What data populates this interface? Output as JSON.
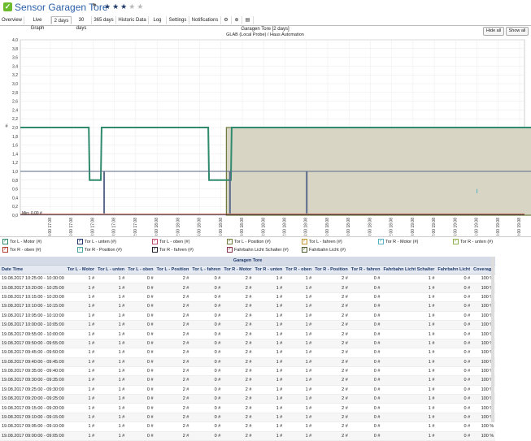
{
  "header": {
    "title": "Sensor Garagen Tore",
    "flag": "⚑",
    "rating": 3,
    "max_rating": 5
  },
  "tabs": [
    "Overview",
    "Live Graph",
    "2 days",
    "30 days",
    "365 days",
    "Historic Data",
    "Log",
    "Settings",
    "Notifications",
    "",
    "",
    ""
  ],
  "active_tab": "2 days",
  "buttons": {
    "hide_all": "Hide all",
    "show_all": "Show all"
  },
  "chart_data": {
    "type": "line",
    "title": "Garagen Tore [2 days]",
    "subtitle": "GLAB (Local Probe) / Haus Automation",
    "ylabel": "#",
    "ylim": [
      0,
      4.0
    ],
    "yticks": [
      "0,0",
      "0,2",
      "0,4",
      "0,6",
      "0,8",
      "1,0",
      "1,2",
      "1,4",
      "1,6",
      "1,8",
      "2,0",
      "2,2",
      "2,4",
      "2,6",
      "2,8",
      "3,0",
      "3,2",
      "3,4",
      "3,6",
      "3,8",
      "4,0"
    ],
    "xticks": [
      "17.08 14:00",
      "17.08 16:00",
      "17.08 18:00",
      "17.08 20:00",
      "17.08 22:00",
      "18.08 00:00",
      "18.08 02:00",
      "18.08 04:00",
      "18.08 06:00",
      "18.08 08:00",
      "18.08 10:00",
      "18.08 12:00",
      "18.08 14:00",
      "18.08 16:00",
      "18.08 18:00",
      "18.08 20:00",
      "18.08 22:00",
      "19.08 00:00",
      "19.08 02:00",
      "19.08 04:00",
      "19.08 06:00",
      "19.08 08:00",
      "19.08 10:00"
    ],
    "max_label": "Max: 2,00 #",
    "min_label": "Min: 0,00 #",
    "grid": true,
    "series": [
      {
        "name": "Tor L - Motor",
        "color": "#2f8a6e"
      },
      {
        "name": "Tor L - unten",
        "color": "#1f3a6b"
      },
      {
        "name": "Tor L - oben",
        "color": "#c44a6a"
      },
      {
        "name": "Tor L - Position",
        "color": "#6b7a3b"
      },
      {
        "name": "Tor L - fahren",
        "color": "#c2952d"
      },
      {
        "name": "Tor R - Motor",
        "color": "#5ab3c4"
      },
      {
        "name": "Tor R - unten",
        "color": "#8fb04a"
      },
      {
        "name": "Tor R - oben",
        "color": "#b33a2a"
      },
      {
        "name": "Tor R - Position",
        "color": "#4aa6a0"
      },
      {
        "name": "Tor R - fahren",
        "color": "#222233"
      },
      {
        "name": "Fahrbahn Licht Schalter",
        "color": "#8a2e4a"
      },
      {
        "name": "Fahrbahn Licht",
        "color": "#4a5a2a"
      }
    ]
  },
  "legend": [
    "Tor L - Motor (#)",
    "Tor L - unten (#)",
    "Tor L - oben (#)",
    "Tor L - Position (#)",
    "Tor L - fahren (#)",
    "Tor R - Motor (#)",
    "Tor R - unten (#)",
    "Tor R - oben (#)",
    "Tor R - Position (#)",
    "Tor R - fahren (#)",
    "Fahrbahn Licht Schalter (#)",
    "Fahrbahn Licht (#)"
  ],
  "table": {
    "group_header": "Garagen Tore",
    "columns": [
      "Date Time",
      "Tor L - Motor",
      "Tor L - unten",
      "Tor L - oben",
      "Tor L - Position",
      "Tor L - fahren",
      "Tor R - Motor",
      "Tor R - unten",
      "Tor R - oben",
      "Tor R - Position",
      "Tor R - fahren",
      "Fahrbahn Licht Schalter",
      "Fahrbahn Licht",
      "Coverage"
    ],
    "rows": [
      [
        "19.08.2017 10:25:00 - 10:30:00",
        "1 #",
        "1 #",
        "0 #",
        "2 #",
        "0 #",
        "2 #",
        "1 #",
        "1 #",
        "2 #",
        "0 #",
        "1 #",
        "0 #",
        "100 %"
      ],
      [
        "19.08.2017 10:20:00 - 10:25:00",
        "1 #",
        "1 #",
        "0 #",
        "2 #",
        "0 #",
        "2 #",
        "1 #",
        "1 #",
        "2 #",
        "0 #",
        "1 #",
        "0 #",
        "100 %"
      ],
      [
        "19.08.2017 10:15:00 - 10:20:00",
        "1 #",
        "1 #",
        "0 #",
        "2 #",
        "0 #",
        "2 #",
        "1 #",
        "1 #",
        "2 #",
        "0 #",
        "1 #",
        "0 #",
        "100 %"
      ],
      [
        "19.08.2017 10:10:00 - 10:15:00",
        "1 #",
        "1 #",
        "0 #",
        "2 #",
        "0 #",
        "2 #",
        "1 #",
        "1 #",
        "2 #",
        "0 #",
        "1 #",
        "0 #",
        "100 %"
      ],
      [
        "19.08.2017 10:05:00 - 10:10:00",
        "1 #",
        "1 #",
        "0 #",
        "2 #",
        "0 #",
        "2 #",
        "1 #",
        "1 #",
        "2 #",
        "0 #",
        "1 #",
        "0 #",
        "100 %"
      ],
      [
        "19.08.2017 10:00:00 - 10:05:00",
        "1 #",
        "1 #",
        "0 #",
        "2 #",
        "0 #",
        "2 #",
        "1 #",
        "1 #",
        "2 #",
        "0 #",
        "1 #",
        "0 #",
        "100 %"
      ],
      [
        "19.08.2017 09:55:00 - 10:00:00",
        "1 #",
        "1 #",
        "0 #",
        "2 #",
        "0 #",
        "2 #",
        "1 #",
        "1 #",
        "2 #",
        "0 #",
        "1 #",
        "0 #",
        "100 %"
      ],
      [
        "19.08.2017 09:50:00 - 09:55:00",
        "1 #",
        "1 #",
        "0 #",
        "2 #",
        "0 #",
        "2 #",
        "1 #",
        "1 #",
        "2 #",
        "0 #",
        "1 #",
        "0 #",
        "100 %"
      ],
      [
        "19.08.2017 09:45:00 - 09:50:00",
        "1 #",
        "1 #",
        "0 #",
        "2 #",
        "0 #",
        "2 #",
        "1 #",
        "1 #",
        "2 #",
        "0 #",
        "1 #",
        "0 #",
        "100 %"
      ],
      [
        "19.08.2017 09:40:00 - 09:45:00",
        "1 #",
        "1 #",
        "0 #",
        "2 #",
        "0 #",
        "2 #",
        "1 #",
        "1 #",
        "2 #",
        "0 #",
        "1 #",
        "0 #",
        "100 %"
      ],
      [
        "19.08.2017 09:35:00 - 09:40:00",
        "1 #",
        "1 #",
        "0 #",
        "2 #",
        "0 #",
        "2 #",
        "1 #",
        "1 #",
        "2 #",
        "0 #",
        "1 #",
        "0 #",
        "100 %"
      ],
      [
        "19.08.2017 09:30:00 - 09:35:00",
        "1 #",
        "1 #",
        "0 #",
        "2 #",
        "0 #",
        "2 #",
        "1 #",
        "1 #",
        "2 #",
        "0 #",
        "1 #",
        "0 #",
        "100 %"
      ],
      [
        "19.08.2017 09:25:00 - 09:30:00",
        "1 #",
        "1 #",
        "0 #",
        "2 #",
        "0 #",
        "2 #",
        "1 #",
        "1 #",
        "2 #",
        "0 #",
        "1 #",
        "0 #",
        "100 %"
      ],
      [
        "19.08.2017 09:20:00 - 09:25:00",
        "1 #",
        "1 #",
        "0 #",
        "2 #",
        "0 #",
        "2 #",
        "1 #",
        "1 #",
        "2 #",
        "0 #",
        "1 #",
        "0 #",
        "100 %"
      ],
      [
        "19.08.2017 09:15:00 - 09:20:00",
        "1 #",
        "1 #",
        "0 #",
        "2 #",
        "0 #",
        "2 #",
        "1 #",
        "1 #",
        "2 #",
        "0 #",
        "1 #",
        "0 #",
        "100 %"
      ],
      [
        "19.08.2017 09:10:00 - 09:15:00",
        "1 #",
        "1 #",
        "0 #",
        "2 #",
        "0 #",
        "2 #",
        "1 #",
        "1 #",
        "2 #",
        "0 #",
        "1 #",
        "0 #",
        "100 %"
      ],
      [
        "19.08.2017 09:05:00 - 09:10:00",
        "1 #",
        "1 #",
        "0 #",
        "2 #",
        "0 #",
        "2 #",
        "1 #",
        "1 #",
        "2 #",
        "0 #",
        "1 #",
        "0 #",
        "100 %"
      ],
      [
        "19.08.2017 09:00:00 - 09:05:00",
        "1 #",
        "1 #",
        "0 #",
        "2 #",
        "0 #",
        "2 #",
        "1 #",
        "1 #",
        "2 #",
        "0 #",
        "1 #",
        "0 #",
        "100 %"
      ]
    ]
  }
}
